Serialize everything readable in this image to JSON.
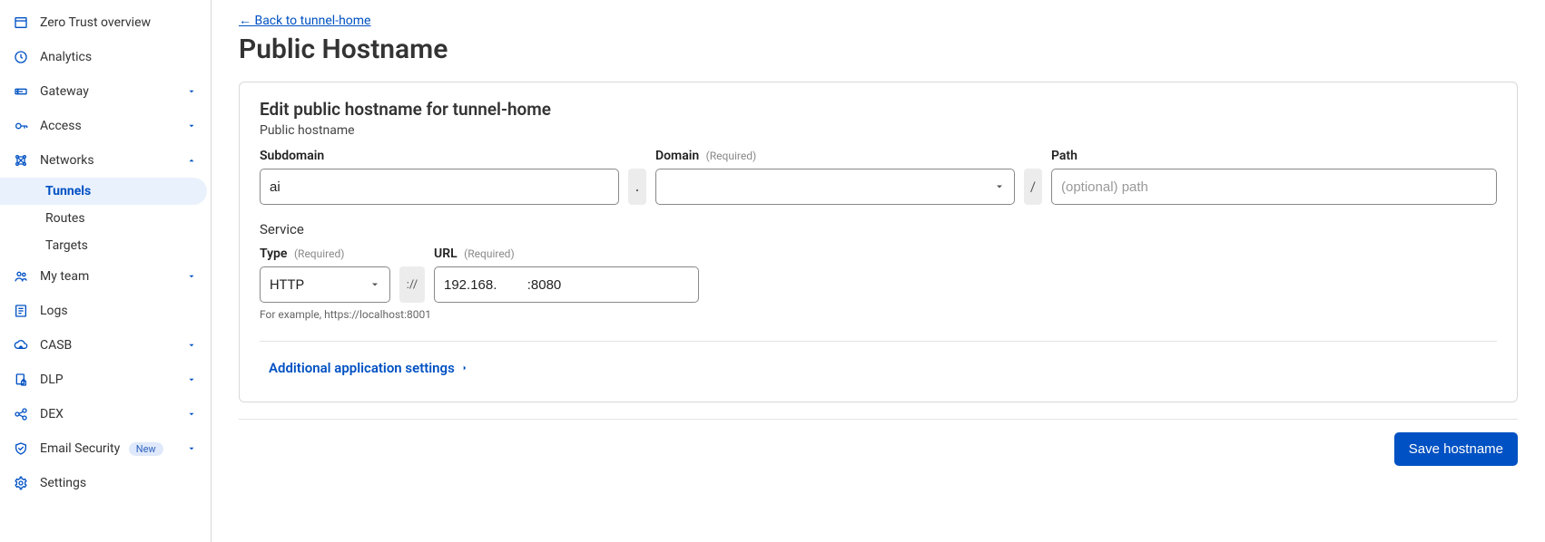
{
  "sidebar": {
    "items": [
      {
        "id": "overview",
        "label": "Zero Trust overview",
        "icon": "window-icon",
        "expandable": false
      },
      {
        "id": "analytics",
        "label": "Analytics",
        "icon": "clock-icon",
        "expandable": false
      },
      {
        "id": "gateway",
        "label": "Gateway",
        "icon": "gateway-icon",
        "expandable": true,
        "expanded": false
      },
      {
        "id": "access",
        "label": "Access",
        "icon": "access-icon",
        "expandable": true,
        "expanded": false
      },
      {
        "id": "networks",
        "label": "Networks",
        "icon": "networks-icon",
        "expandable": true,
        "expanded": true,
        "children": [
          {
            "id": "tunnels",
            "label": "Tunnels",
            "active": true
          },
          {
            "id": "routes",
            "label": "Routes",
            "active": false
          },
          {
            "id": "targets",
            "label": "Targets",
            "active": false
          }
        ]
      },
      {
        "id": "myteam",
        "label": "My team",
        "icon": "team-icon",
        "expandable": true,
        "expanded": false
      },
      {
        "id": "logs",
        "label": "Logs",
        "icon": "logs-icon",
        "expandable": false
      },
      {
        "id": "casb",
        "label": "CASB",
        "icon": "casb-icon",
        "expandable": true,
        "expanded": false
      },
      {
        "id": "dlp",
        "label": "DLP",
        "icon": "dlp-icon",
        "expandable": true,
        "expanded": false
      },
      {
        "id": "dex",
        "label": "DEX",
        "icon": "dex-icon",
        "expandable": true,
        "expanded": false
      },
      {
        "id": "emailsec",
        "label": "Email Security",
        "icon": "email-icon",
        "expandable": true,
        "expanded": false,
        "badge": "New"
      },
      {
        "id": "settings",
        "label": "Settings",
        "icon": "gear-icon",
        "expandable": false
      }
    ]
  },
  "back_link": "← Back to tunnel-home",
  "page_title": "Public Hostname",
  "panel": {
    "title": "Edit public hostname for tunnel-home",
    "subtitle": "Public hostname",
    "hostname_row": {
      "subdomain": {
        "label": "Subdomain",
        "value": "ai"
      },
      "dot": ".",
      "domain": {
        "label": "Domain",
        "required": "(Required)",
        "value": ""
      },
      "slash": "/",
      "path": {
        "label": "Path",
        "placeholder": "(optional) path",
        "value": ""
      }
    },
    "service_label": "Service",
    "service_row": {
      "type": {
        "label": "Type",
        "required": "(Required)",
        "value": "HTTP"
      },
      "scheme_sep": "://",
      "url": {
        "label": "URL",
        "required": "(Required)",
        "value": "192.168.        :8080"
      }
    },
    "help": "For example, https://localhost:8001",
    "expander": "Additional application settings"
  },
  "save_button": "Save hostname"
}
